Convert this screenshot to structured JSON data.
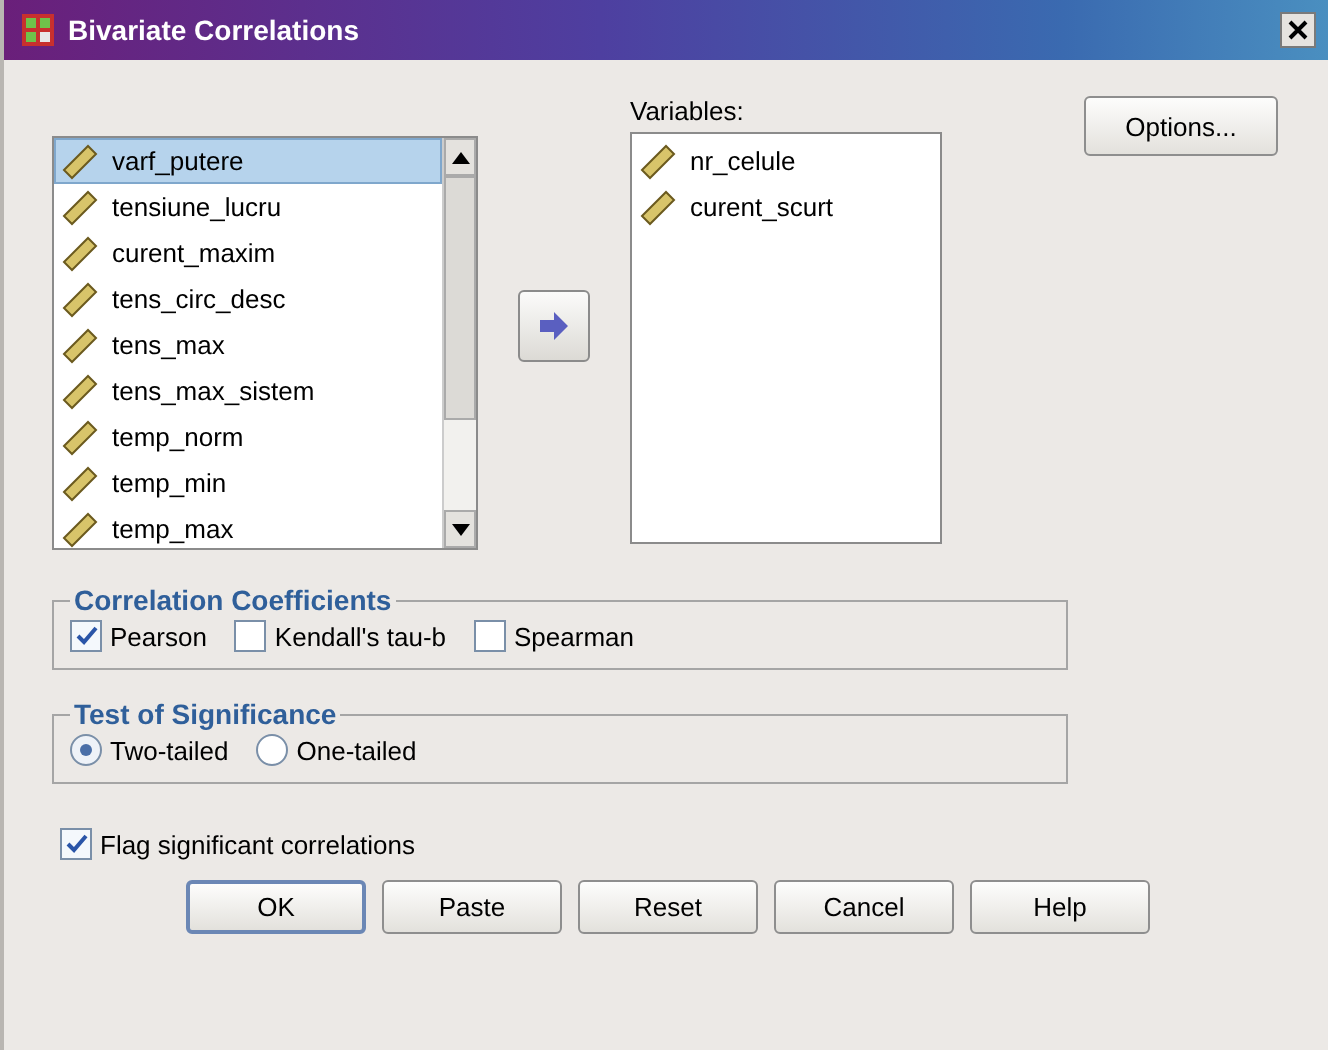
{
  "window": {
    "title": "Bivariate Correlations"
  },
  "source_list": {
    "items": [
      {
        "label": "varf_putere",
        "selected": true
      },
      {
        "label": "tensiune_lucru",
        "selected": false
      },
      {
        "label": "curent_maxim",
        "selected": false
      },
      {
        "label": "tens_circ_desc",
        "selected": false
      },
      {
        "label": "tens_max",
        "selected": false
      },
      {
        "label": "tens_max_sistem",
        "selected": false
      },
      {
        "label": "temp_norm",
        "selected": false
      },
      {
        "label": "temp_min",
        "selected": false
      },
      {
        "label": "temp_max",
        "selected": false
      }
    ]
  },
  "variables": {
    "label": "Variables:",
    "items": [
      {
        "label": "nr_celule"
      },
      {
        "label": "curent_scurt"
      }
    ]
  },
  "options_button": {
    "label": "Options..."
  },
  "coefficients": {
    "title": "Correlation Coefficients",
    "options": [
      {
        "label": "Pearson",
        "checked": true
      },
      {
        "label": "Kendall's tau-b",
        "checked": false
      },
      {
        "label": "Spearman",
        "checked": false
      }
    ]
  },
  "significance": {
    "title": "Test of Significance",
    "options": [
      {
        "label": "Two-tailed",
        "selected": true
      },
      {
        "label": "One-tailed",
        "selected": false
      }
    ]
  },
  "flag": {
    "label": "Flag significant correlations",
    "checked": true
  },
  "buttons": [
    {
      "label": "OK",
      "default": true
    },
    {
      "label": "Paste",
      "default": false
    },
    {
      "label": "Reset",
      "default": false
    },
    {
      "label": "Cancel",
      "default": false
    },
    {
      "label": "Help",
      "default": false
    }
  ]
}
